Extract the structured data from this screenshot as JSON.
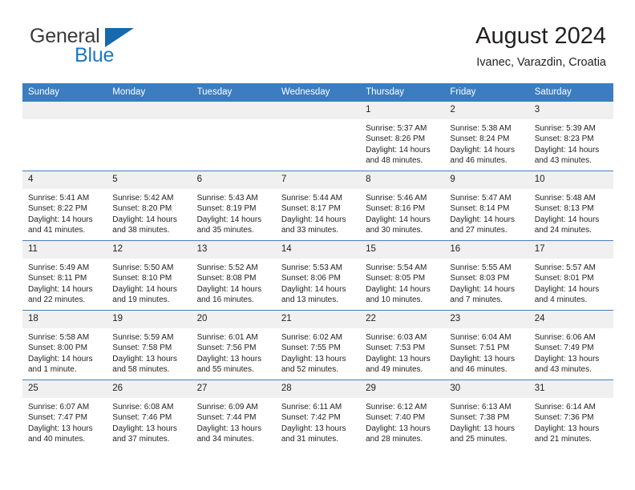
{
  "brand": {
    "line1": "General",
    "line2": "Blue",
    "triangle_color": "#1769ad",
    "blue_text_color": "#1b79c4"
  },
  "header": {
    "title": "August 2024",
    "location": "Ivanec, Varazdin, Croatia"
  },
  "theme": {
    "header_row_bg": "#3b7dbf",
    "day_number_bg": "#f0f0f0",
    "row_divider": "#4a7ebb",
    "text": "#221f20"
  },
  "weekday_headers": [
    "Sunday",
    "Monday",
    "Tuesday",
    "Wednesday",
    "Thursday",
    "Friday",
    "Saturday"
  ],
  "labels": {
    "sunrise_prefix": "Sunrise:",
    "sunset_prefix": "Sunset:",
    "daylight_prefix": "Daylight:"
  },
  "weeks": [
    [
      {
        "day": "",
        "sunrise": "",
        "sunset": "",
        "daylight_line1": "",
        "daylight_line2": "",
        "empty": true
      },
      {
        "day": "",
        "sunrise": "",
        "sunset": "",
        "daylight_line1": "",
        "daylight_line2": "",
        "empty": true
      },
      {
        "day": "",
        "sunrise": "",
        "sunset": "",
        "daylight_line1": "",
        "daylight_line2": "",
        "empty": true
      },
      {
        "day": "",
        "sunrise": "",
        "sunset": "",
        "daylight_line1": "",
        "daylight_line2": "",
        "empty": true
      },
      {
        "day": "1",
        "sunrise": "Sunrise: 5:37 AM",
        "sunset": "Sunset: 8:26 PM",
        "daylight_line1": "Daylight: 14 hours",
        "daylight_line2": "and 48 minutes.",
        "empty": false
      },
      {
        "day": "2",
        "sunrise": "Sunrise: 5:38 AM",
        "sunset": "Sunset: 8:24 PM",
        "daylight_line1": "Daylight: 14 hours",
        "daylight_line2": "and 46 minutes.",
        "empty": false
      },
      {
        "day": "3",
        "sunrise": "Sunrise: 5:39 AM",
        "sunset": "Sunset: 8:23 PM",
        "daylight_line1": "Daylight: 14 hours",
        "daylight_line2": "and 43 minutes.",
        "empty": false
      }
    ],
    [
      {
        "day": "4",
        "sunrise": "Sunrise: 5:41 AM",
        "sunset": "Sunset: 8:22 PM",
        "daylight_line1": "Daylight: 14 hours",
        "daylight_line2": "and 41 minutes.",
        "empty": false
      },
      {
        "day": "5",
        "sunrise": "Sunrise: 5:42 AM",
        "sunset": "Sunset: 8:20 PM",
        "daylight_line1": "Daylight: 14 hours",
        "daylight_line2": "and 38 minutes.",
        "empty": false
      },
      {
        "day": "6",
        "sunrise": "Sunrise: 5:43 AM",
        "sunset": "Sunset: 8:19 PM",
        "daylight_line1": "Daylight: 14 hours",
        "daylight_line2": "and 35 minutes.",
        "empty": false
      },
      {
        "day": "7",
        "sunrise": "Sunrise: 5:44 AM",
        "sunset": "Sunset: 8:17 PM",
        "daylight_line1": "Daylight: 14 hours",
        "daylight_line2": "and 33 minutes.",
        "empty": false
      },
      {
        "day": "8",
        "sunrise": "Sunrise: 5:46 AM",
        "sunset": "Sunset: 8:16 PM",
        "daylight_line1": "Daylight: 14 hours",
        "daylight_line2": "and 30 minutes.",
        "empty": false
      },
      {
        "day": "9",
        "sunrise": "Sunrise: 5:47 AM",
        "sunset": "Sunset: 8:14 PM",
        "daylight_line1": "Daylight: 14 hours",
        "daylight_line2": "and 27 minutes.",
        "empty": false
      },
      {
        "day": "10",
        "sunrise": "Sunrise: 5:48 AM",
        "sunset": "Sunset: 8:13 PM",
        "daylight_line1": "Daylight: 14 hours",
        "daylight_line2": "and 24 minutes.",
        "empty": false
      }
    ],
    [
      {
        "day": "11",
        "sunrise": "Sunrise: 5:49 AM",
        "sunset": "Sunset: 8:11 PM",
        "daylight_line1": "Daylight: 14 hours",
        "daylight_line2": "and 22 minutes.",
        "empty": false
      },
      {
        "day": "12",
        "sunrise": "Sunrise: 5:50 AM",
        "sunset": "Sunset: 8:10 PM",
        "daylight_line1": "Daylight: 14 hours",
        "daylight_line2": "and 19 minutes.",
        "empty": false
      },
      {
        "day": "13",
        "sunrise": "Sunrise: 5:52 AM",
        "sunset": "Sunset: 8:08 PM",
        "daylight_line1": "Daylight: 14 hours",
        "daylight_line2": "and 16 minutes.",
        "empty": false
      },
      {
        "day": "14",
        "sunrise": "Sunrise: 5:53 AM",
        "sunset": "Sunset: 8:06 PM",
        "daylight_line1": "Daylight: 14 hours",
        "daylight_line2": "and 13 minutes.",
        "empty": false
      },
      {
        "day": "15",
        "sunrise": "Sunrise: 5:54 AM",
        "sunset": "Sunset: 8:05 PM",
        "daylight_line1": "Daylight: 14 hours",
        "daylight_line2": "and 10 minutes.",
        "empty": false
      },
      {
        "day": "16",
        "sunrise": "Sunrise: 5:55 AM",
        "sunset": "Sunset: 8:03 PM",
        "daylight_line1": "Daylight: 14 hours",
        "daylight_line2": "and 7 minutes.",
        "empty": false
      },
      {
        "day": "17",
        "sunrise": "Sunrise: 5:57 AM",
        "sunset": "Sunset: 8:01 PM",
        "daylight_line1": "Daylight: 14 hours",
        "daylight_line2": "and 4 minutes.",
        "empty": false
      }
    ],
    [
      {
        "day": "18",
        "sunrise": "Sunrise: 5:58 AM",
        "sunset": "Sunset: 8:00 PM",
        "daylight_line1": "Daylight: 14 hours",
        "daylight_line2": "and 1 minute.",
        "empty": false
      },
      {
        "day": "19",
        "sunrise": "Sunrise: 5:59 AM",
        "sunset": "Sunset: 7:58 PM",
        "daylight_line1": "Daylight: 13 hours",
        "daylight_line2": "and 58 minutes.",
        "empty": false
      },
      {
        "day": "20",
        "sunrise": "Sunrise: 6:01 AM",
        "sunset": "Sunset: 7:56 PM",
        "daylight_line1": "Daylight: 13 hours",
        "daylight_line2": "and 55 minutes.",
        "empty": false
      },
      {
        "day": "21",
        "sunrise": "Sunrise: 6:02 AM",
        "sunset": "Sunset: 7:55 PM",
        "daylight_line1": "Daylight: 13 hours",
        "daylight_line2": "and 52 minutes.",
        "empty": false
      },
      {
        "day": "22",
        "sunrise": "Sunrise: 6:03 AM",
        "sunset": "Sunset: 7:53 PM",
        "daylight_line1": "Daylight: 13 hours",
        "daylight_line2": "and 49 minutes.",
        "empty": false
      },
      {
        "day": "23",
        "sunrise": "Sunrise: 6:04 AM",
        "sunset": "Sunset: 7:51 PM",
        "daylight_line1": "Daylight: 13 hours",
        "daylight_line2": "and 46 minutes.",
        "empty": false
      },
      {
        "day": "24",
        "sunrise": "Sunrise: 6:06 AM",
        "sunset": "Sunset: 7:49 PM",
        "daylight_line1": "Daylight: 13 hours",
        "daylight_line2": "and 43 minutes.",
        "empty": false
      }
    ],
    [
      {
        "day": "25",
        "sunrise": "Sunrise: 6:07 AM",
        "sunset": "Sunset: 7:47 PM",
        "daylight_line1": "Daylight: 13 hours",
        "daylight_line2": "and 40 minutes.",
        "empty": false
      },
      {
        "day": "26",
        "sunrise": "Sunrise: 6:08 AM",
        "sunset": "Sunset: 7:46 PM",
        "daylight_line1": "Daylight: 13 hours",
        "daylight_line2": "and 37 minutes.",
        "empty": false
      },
      {
        "day": "27",
        "sunrise": "Sunrise: 6:09 AM",
        "sunset": "Sunset: 7:44 PM",
        "daylight_line1": "Daylight: 13 hours",
        "daylight_line2": "and 34 minutes.",
        "empty": false
      },
      {
        "day": "28",
        "sunrise": "Sunrise: 6:11 AM",
        "sunset": "Sunset: 7:42 PM",
        "daylight_line1": "Daylight: 13 hours",
        "daylight_line2": "and 31 minutes.",
        "empty": false
      },
      {
        "day": "29",
        "sunrise": "Sunrise: 6:12 AM",
        "sunset": "Sunset: 7:40 PM",
        "daylight_line1": "Daylight: 13 hours",
        "daylight_line2": "and 28 minutes.",
        "empty": false
      },
      {
        "day": "30",
        "sunrise": "Sunrise: 6:13 AM",
        "sunset": "Sunset: 7:38 PM",
        "daylight_line1": "Daylight: 13 hours",
        "daylight_line2": "and 25 minutes.",
        "empty": false
      },
      {
        "day": "31",
        "sunrise": "Sunrise: 6:14 AM",
        "sunset": "Sunset: 7:36 PM",
        "daylight_line1": "Daylight: 13 hours",
        "daylight_line2": "and 21 minutes.",
        "empty": false
      }
    ]
  ]
}
